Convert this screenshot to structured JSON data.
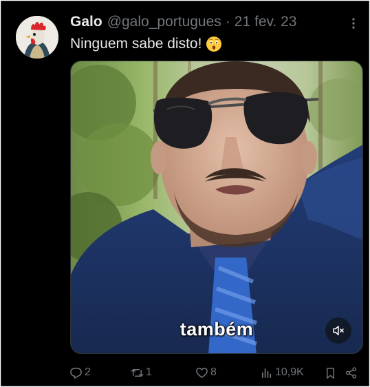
{
  "tweet": {
    "display_name": "Galo",
    "handle": "@galo_portugues",
    "separator": "·",
    "date": "21 fev. 23",
    "text": "Ninguem sabe disto!",
    "emoji": "astonished-face-emoji"
  },
  "video": {
    "caption": "também",
    "mute_icon": "speaker-muted-icon"
  },
  "actions": {
    "replies": "2",
    "retweets": "1",
    "likes": "8",
    "views": "10,9K"
  },
  "colors": {
    "background": "#000000",
    "primary_text": "#e7e9ea",
    "secondary_text": "#71767b",
    "border": "#2f3336"
  }
}
